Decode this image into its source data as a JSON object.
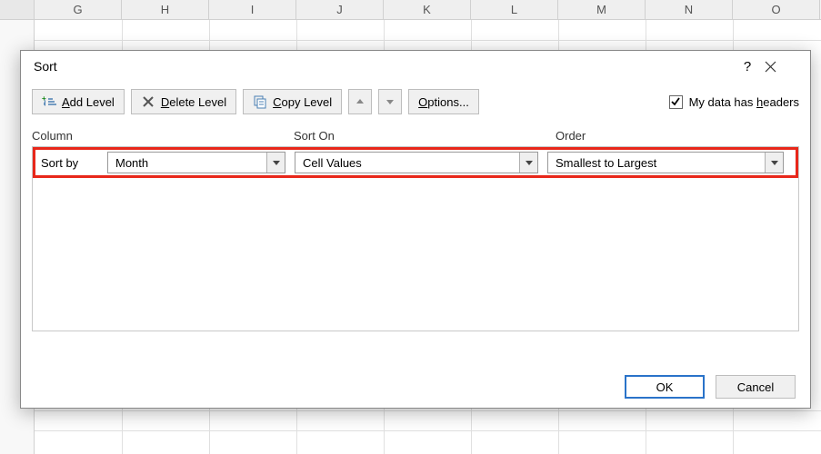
{
  "spreadsheet": {
    "columns": [
      "G",
      "H",
      "I",
      "J",
      "K",
      "L",
      "M",
      "N",
      "O"
    ]
  },
  "dialog": {
    "title": "Sort",
    "help_tooltip": "?",
    "toolbar": {
      "add_level": "Add Level",
      "delete_level": "Delete Level",
      "copy_level": "Copy Level",
      "options": "Options...",
      "my_data_has_headers": "My data has headers",
      "headers_checked": true
    },
    "grid_headers": {
      "column": "Column",
      "sort_on": "Sort On",
      "order": "Order"
    },
    "sort_rows": [
      {
        "label": "Sort by",
        "column_value": "Month",
        "sort_on_value": "Cell Values",
        "order_value": "Smallest to Largest"
      }
    ],
    "footer": {
      "ok": "OK",
      "cancel": "Cancel"
    }
  }
}
